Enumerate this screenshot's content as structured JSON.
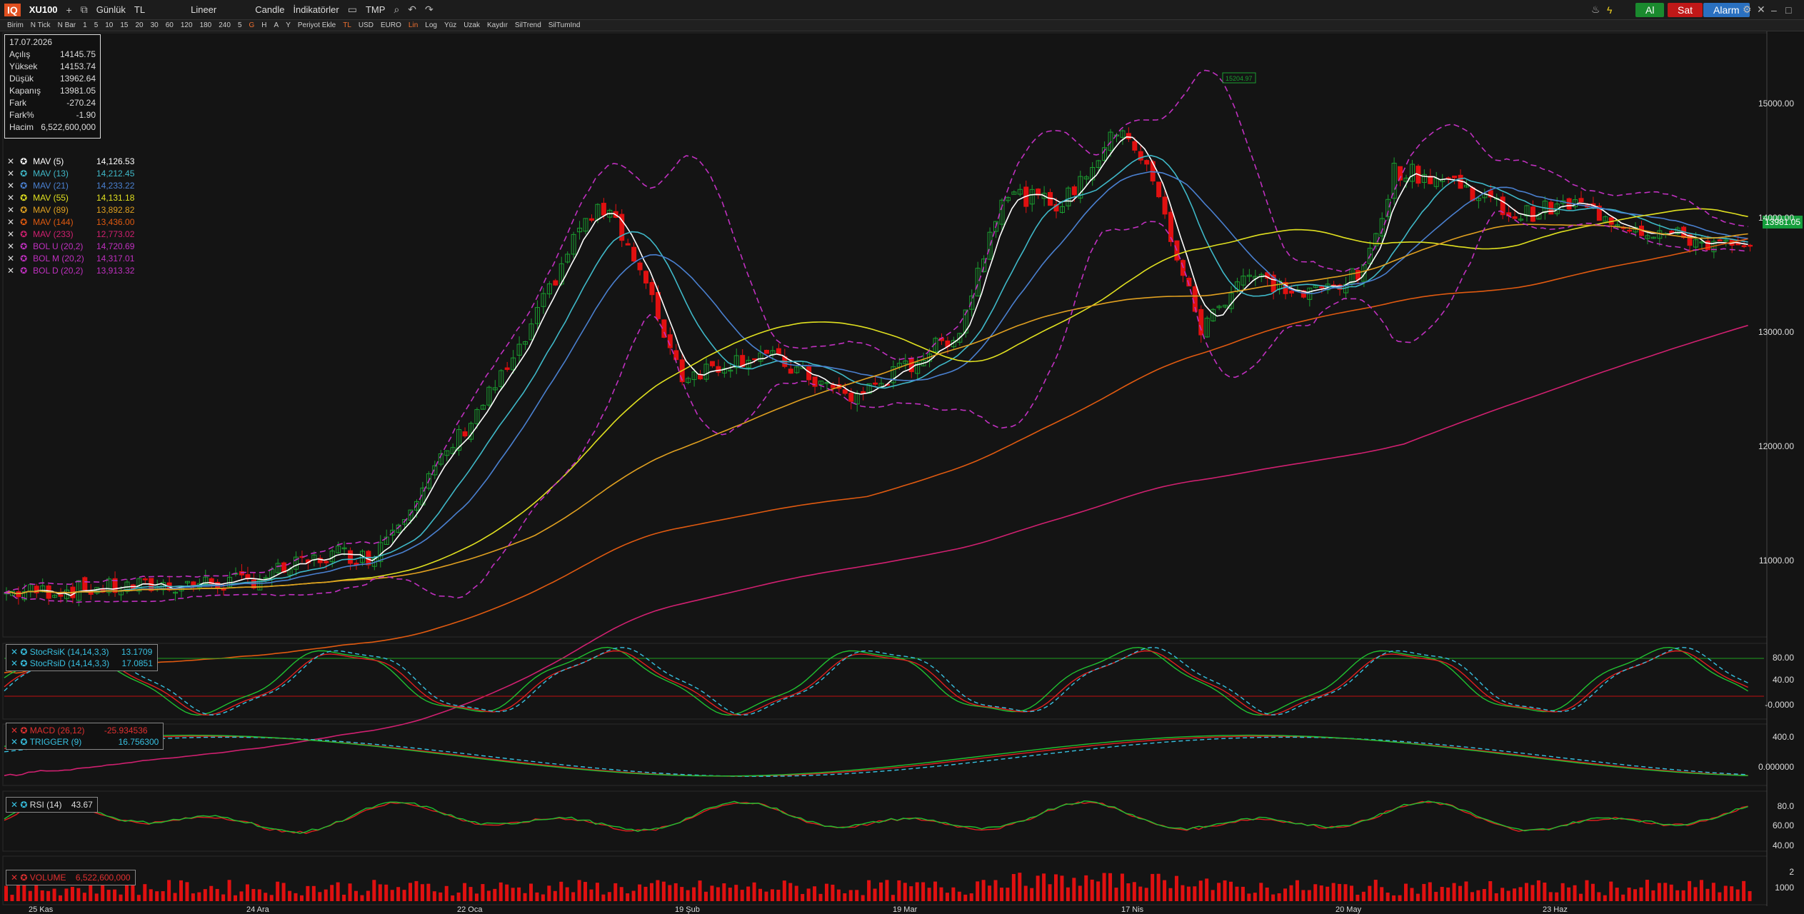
{
  "toolbar": {
    "logo": "IQ",
    "symbol": "XU100",
    "period": "Günlük",
    "currency": "TL",
    "line_type": "Lineer",
    "chart_type": "Candle",
    "indicators": "İndikatörler",
    "template": "TMP",
    "buy": "Al",
    "sell": "Sat",
    "alarm": "Alarm"
  },
  "toolbar2": {
    "items": [
      "Birim",
      "N Tick",
      "N Bar",
      "1",
      "5",
      "10",
      "15",
      "20",
      "30",
      "60",
      "120",
      "180",
      "240",
      "5",
      "G",
      "H",
      "A",
      "Y",
      "Periyot Ekle",
      "TL",
      "USD",
      "EURO",
      "Lin",
      "Log",
      "Yüz",
      "Uzak",
      "Kaydır",
      "SilTrend",
      "SilTumInd"
    ]
  },
  "ohlc": [
    {
      "label": "Açılış",
      "value": "14145.75"
    },
    {
      "label": "Yüksek",
      "value": "14153.74"
    },
    {
      "label": "Düşük",
      "value": "13962.64"
    },
    {
      "label": "Kapanış",
      "value": "13981.05"
    },
    {
      "label": "Fark",
      "value": "-270.24"
    },
    {
      "label": "Fark%",
      "value": "-1.90"
    },
    {
      "label": "Hacim",
      "value": "6,522,600,000"
    }
  ],
  "ohlc_date": "17.07.2026",
  "legend": [
    {
      "name": "MAV (5)",
      "value": "14,126.53",
      "color": "#ffffff"
    },
    {
      "name": "MAV (13)",
      "value": "14,212.45",
      "color": "#3fb8c8"
    },
    {
      "name": "MAV (21)",
      "value": "14,233.22",
      "color": "#4a80d0"
    },
    {
      "name": "MAV (55)",
      "value": "14,131.18",
      "color": "#e0e020"
    },
    {
      "name": "MAV (89)",
      "value": "13,892.82",
      "color": "#e0a020"
    },
    {
      "name": "MAV (144)",
      "value": "13,436.00",
      "color": "#e05a10"
    },
    {
      "name": "MAV (233)",
      "value": "12,773.02",
      "color": "#d02070"
    },
    {
      "name": "BOL U (20,2)",
      "value": "14,720.69",
      "color": "#c030c0"
    },
    {
      "name": "BOL M (20,2)",
      "value": "14,317.01",
      "color": "#c030c0"
    },
    {
      "name": "BOL D (20,2)",
      "value": "13,913.32",
      "color": "#c030c0"
    }
  ],
  "price_axis": [
    "15000.00",
    "14000.00",
    "13000.00",
    "12000.00",
    "11000.00"
  ],
  "last_price": "13981.05",
  "peak_label": "15204.97",
  "stoch": {
    "k_label": "StocRsiK (14,14,3,3)",
    "k_value": "13.1709",
    "d_label": "StocRsiD (14,14,3,3)",
    "d_value": "17.0851",
    "axis": [
      "80.00",
      "40.00",
      "-0.0000"
    ]
  },
  "macd": {
    "macd_label": "MACD (26,12)",
    "macd_value": "-25.934536",
    "trig_label": "TRIGGER (9)",
    "trig_value": "16.756300",
    "axis": [
      "400.0",
      "0.000000"
    ]
  },
  "rsi": {
    "label": "RSI (14)",
    "value": "43.67",
    "axis": [
      "80.0",
      "60.00",
      "40.00"
    ]
  },
  "volume": {
    "label": "VOLUME",
    "value": "6,522,600,000",
    "axis": [
      "2",
      "1000"
    ]
  },
  "dates": [
    "25 Kas",
    "24 Ara",
    "22 Oca",
    "19 Şub",
    "19 Mar",
    "17 Nis",
    "20 May",
    "23 Haz"
  ]
}
